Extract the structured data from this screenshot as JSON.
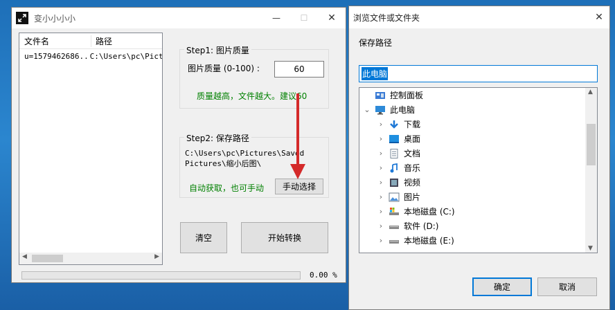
{
  "app": {
    "title": "变小小小小",
    "table": {
      "headers": [
        "文件名",
        "路径"
      ],
      "rows": [
        {
          "name": "u=1579462686...",
          "path": "C:\\Users\\pc\\Pictu"
        }
      ]
    },
    "step1": {
      "title": "Step1: 图片质量",
      "quality_label": "图片质量 (0-100) :",
      "quality_value": "60",
      "hint": "质量越高，文件越大。建议60"
    },
    "step2": {
      "title": "Step2: 保存路径",
      "path_line1": "C:\\Users\\pc\\Pictures\\Saved",
      "path_line2": "Pictures\\缩小后图\\",
      "auto_hint": "自动获取，也可手动",
      "manual_button": "手动选择"
    },
    "buttons": {
      "clear": "清空",
      "start": "开始转换"
    },
    "progress": {
      "value": 0,
      "text": "0.00 %"
    }
  },
  "dialog": {
    "title": "浏览文件或文件夹",
    "label": "保存路径",
    "path_value": "此电脑",
    "tree": [
      {
        "label": "控制面板",
        "icon": "control-panel-icon",
        "level": 0,
        "expander": ""
      },
      {
        "label": "此电脑",
        "icon": "computer-icon",
        "level": 0,
        "expander": "v"
      },
      {
        "label": "下载",
        "icon": "download-icon",
        "level": 1,
        "expander": ">"
      },
      {
        "label": "桌面",
        "icon": "desktop-icon",
        "level": 1,
        "expander": ">"
      },
      {
        "label": "文档",
        "icon": "document-icon",
        "level": 1,
        "expander": ">"
      },
      {
        "label": "音乐",
        "icon": "music-icon",
        "level": 1,
        "expander": ">"
      },
      {
        "label": "视频",
        "icon": "video-icon",
        "level": 1,
        "expander": ">"
      },
      {
        "label": "图片",
        "icon": "pictures-icon",
        "level": 1,
        "expander": ">"
      },
      {
        "label": "本地磁盘 (C:)",
        "icon": "drive-c-icon",
        "level": 1,
        "expander": ">"
      },
      {
        "label": "软件 (D:)",
        "icon": "drive-icon",
        "level": 1,
        "expander": ">"
      },
      {
        "label": "本地磁盘 (E:)",
        "icon": "drive-icon",
        "level": 1,
        "expander": ">"
      }
    ],
    "ok": "确定",
    "cancel": "取消"
  },
  "colors": {
    "accent_blue": "#0078d7",
    "green_text": "#008000",
    "red_arrow": "#d42a2a"
  }
}
